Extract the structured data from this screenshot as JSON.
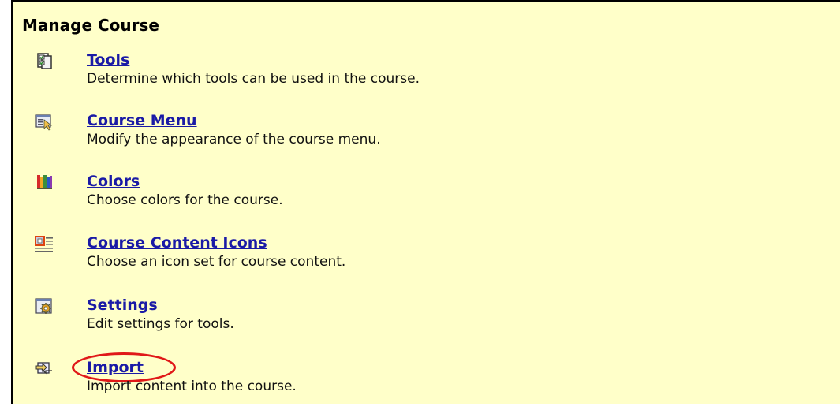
{
  "section": {
    "title": "Manage Course"
  },
  "items": [
    {
      "label": "Tools",
      "description": "Determine which tools can be used in the course.",
      "icon": "tools-checklist-icon"
    },
    {
      "label": "Course Menu",
      "description": "Modify the appearance of the course menu.",
      "icon": "course-menu-icon"
    },
    {
      "label": "Colors",
      "description": "Choose colors for the course.",
      "icon": "colors-icon"
    },
    {
      "label": "Course Content Icons",
      "description": "Choose an icon set for course content.",
      "icon": "content-icons-icon"
    },
    {
      "label": "Settings",
      "description": "Edit settings for tools.",
      "icon": "settings-gear-icon"
    },
    {
      "label": "Import",
      "description": "Import content into the course.",
      "icon": "import-arrows-icon",
      "highlighted": true
    }
  ],
  "colors": {
    "background": "#ffffc9",
    "link": "#1a1aa6",
    "highlight": "#e01818"
  }
}
